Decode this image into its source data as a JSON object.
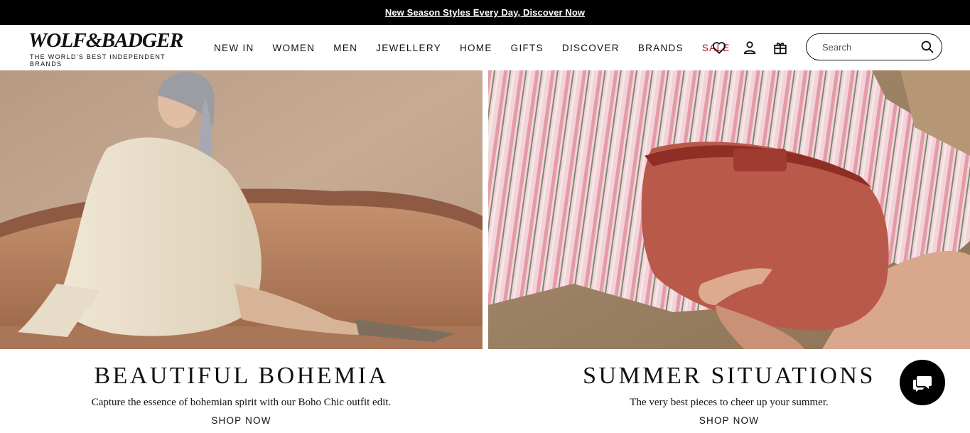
{
  "promo": {
    "text": "New Season Styles Every Day, Discover Now"
  },
  "brand": {
    "name": "WOLF&BADGER",
    "tagline": "THE WORLD'S BEST INDEPENDENT BRANDS"
  },
  "nav": {
    "items": [
      {
        "label": "NEW IN"
      },
      {
        "label": "WOMEN"
      },
      {
        "label": "MEN"
      },
      {
        "label": "JEWELLERY"
      },
      {
        "label": "HOME"
      },
      {
        "label": "GIFTS"
      },
      {
        "label": "DISCOVER"
      },
      {
        "label": "BRANDS"
      },
      {
        "label": "SALE"
      }
    ],
    "sale_color": "#b0121b"
  },
  "icons": {
    "wishlist": "heart-icon",
    "account": "user-icon",
    "bag": "shopping-bag-icon",
    "search": "search-icon",
    "chat": "chat-icon"
  },
  "search": {
    "placeholder": "Search"
  },
  "panels": [
    {
      "title": "BEAUTIFUL BOHEMIA",
      "subtitle": "Capture the essence of bohemian spirit with our Boho Chic outfit edit.",
      "cta": "SHOP NOW"
    },
    {
      "title": "SUMMER SITUATIONS",
      "subtitle": "The very best pieces to cheer up your summer.",
      "cta": "SHOP NOW"
    }
  ]
}
